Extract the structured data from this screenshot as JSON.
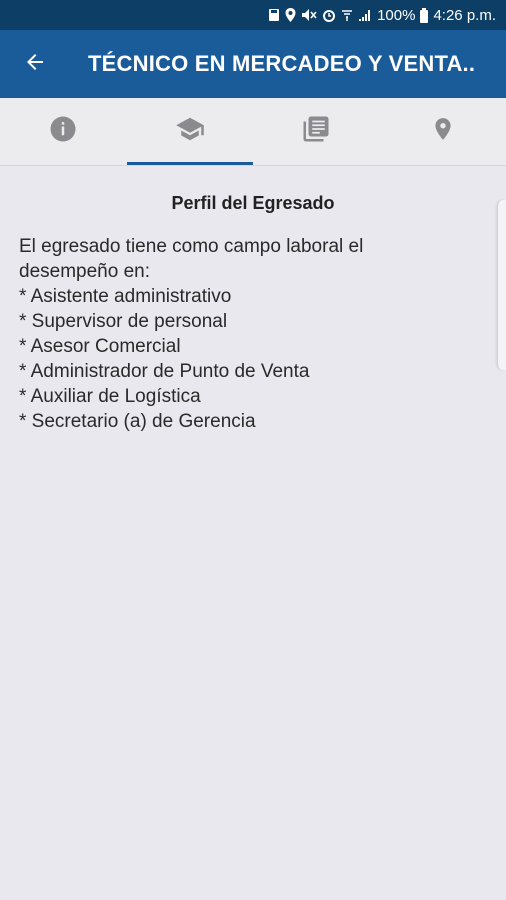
{
  "status_bar": {
    "battery": "100%",
    "time": "4:26 p.m."
  },
  "app_bar": {
    "title": "TÉCNICO EN MERCADEO Y VENTA..",
    "back_icon": "arrow-left-icon"
  },
  "tabs": [
    {
      "icon": "info-icon",
      "active": false
    },
    {
      "icon": "graduation-cap-icon",
      "active": true
    },
    {
      "icon": "document-list-icon",
      "active": false
    },
    {
      "icon": "location-pin-icon",
      "active": false
    }
  ],
  "content": {
    "title": "Perfil del Egresado",
    "lines": [
      "El egresado tiene como campo laboral el",
      "desempeño en:",
      "* Asistente administrativo",
      "* Supervisor de personal",
      "* Asesor Comercial",
      "* Administrador de Punto de Venta",
      "* Auxiliar de Logística",
      "* Secretario (a) de Gerencia"
    ]
  },
  "colors": {
    "status_bar": "#0d3f66",
    "app_bar": "#1a5c99",
    "tab_bar": "#ececef",
    "background": "#e8e8ee",
    "icon_gray": "#8a8a8f"
  }
}
